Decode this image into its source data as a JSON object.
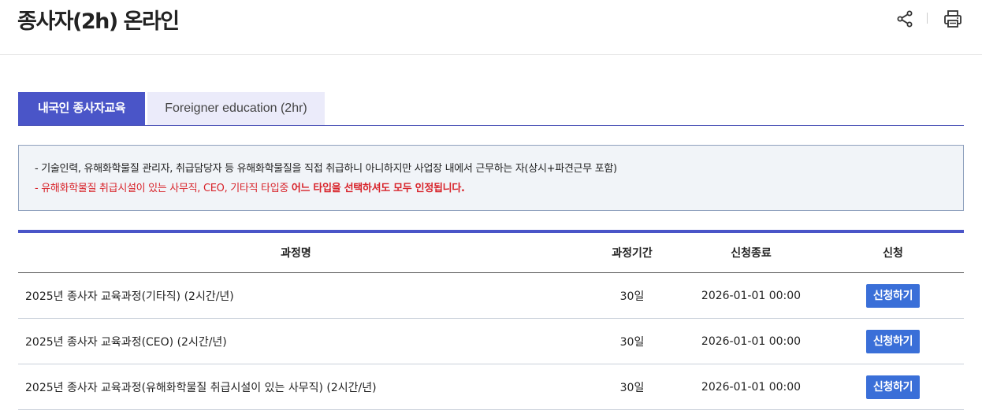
{
  "header": {
    "title": "종사자(2h) 온라인",
    "share_icon": "share-icon",
    "print_icon": "print-icon"
  },
  "tabs": [
    {
      "label": "내국인 종사자교육",
      "active": true
    },
    {
      "label": "Foreigner education (2hr)",
      "active": false
    }
  ],
  "notice": {
    "line1": "- 기술인력, 유해화학물질 관리자, 취급담당자 등 유해화학물질을 직접 취급하니 아니하지만 사업장 내에서 근무하는 자(상시+파견근무 포함)",
    "line2_normal": "- 유해화학물질 취급시설이 있는 사무직, CEO, 기타직 타입중 ",
    "line2_bold": "어느 타입을 선택하셔도 모두 인정됩니다."
  },
  "table": {
    "columns": [
      "과정명",
      "과정기간",
      "신청종료",
      "신청"
    ],
    "rows": [
      {
        "name": "2025년 종사자 교육과정(기타직) (2시간/년)",
        "period": "30일",
        "end": "2026-01-01 00:00",
        "action": "신청하기"
      },
      {
        "name": "2025년 종사자 교육과정(CEO) (2시간/년)",
        "period": "30일",
        "end": "2026-01-01 00:00",
        "action": "신청하기"
      },
      {
        "name": "2025년 종사자 교육과정(유해화학물질 취급시설이 있는 사무직) (2시간/년)",
        "period": "30일",
        "end": "2026-01-01 00:00",
        "action": "신청하기"
      }
    ]
  },
  "colors": {
    "accent": "#4a55c8",
    "button": "#3a6fd8",
    "notice_red": "#d8232a"
  }
}
